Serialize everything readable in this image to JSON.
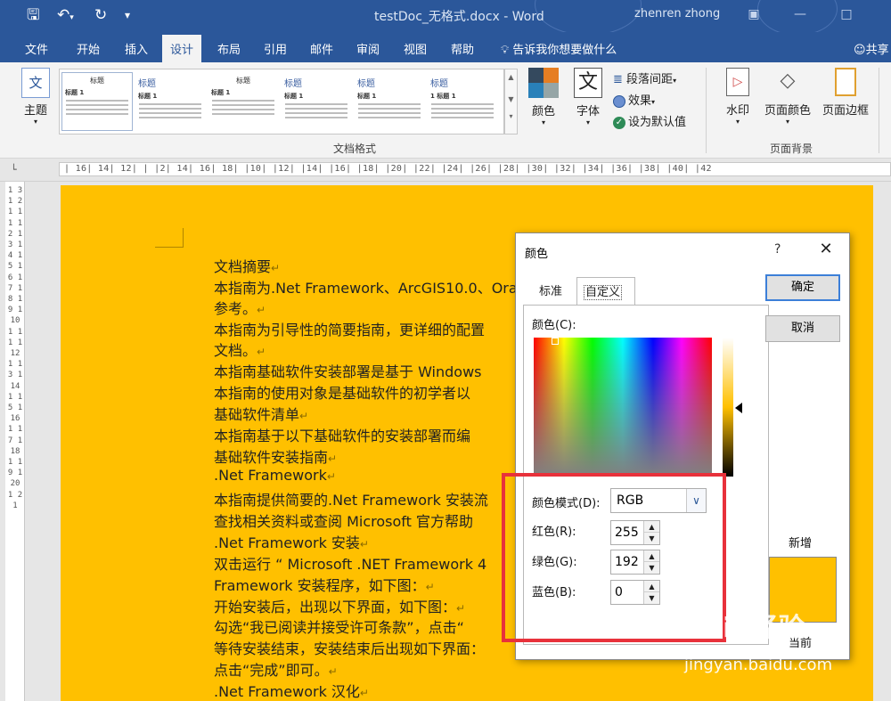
{
  "window": {
    "save_icon": "save-icon",
    "undo_icon": "undo-icon",
    "redo_icon": "redo-icon",
    "title": "testDoc_无格式.docx  -  Word",
    "user": "zhenren zhong"
  },
  "tabs": [
    "文件",
    "开始",
    "插入",
    "设计",
    "布局",
    "引用",
    "邮件",
    "审阅",
    "视图",
    "帮助"
  ],
  "active_tab": "设计",
  "tell_me": "告诉我你想要做什么",
  "share": "共享",
  "ribbon": {
    "theme_label": "主题",
    "theme_icon_text": "文",
    "gallery_thumbs": [
      {
        "title": "标题",
        "h1": "标题 1"
      },
      {
        "title": "标题",
        "h1": "标题 1"
      },
      {
        "title": "标题",
        "h1": "标题 1"
      },
      {
        "title": "标题",
        "h1": "标题 1"
      },
      {
        "title": "标题",
        "h1": "标题 1"
      },
      {
        "title": "标题",
        "h1": "1  标题 1"
      }
    ],
    "colors_label": "颜色",
    "fonts_label": "字体",
    "fonts_icon_text": "文",
    "paragraph_spacing": "段落间距",
    "effects": "效果",
    "set_default": "设为默认值",
    "doc_format_group": "文档格式",
    "watermark": "水印",
    "page_color": "页面颜色",
    "page_borders": "页面边框",
    "page_background_group": "页面背景"
  },
  "ruler_top": "| 16|  14|  12|  |  |2|  14|  16|  18|  |10|  |12|  |14|  |16|  |18|  |20|  |22|  |24|  |26|  |28|  |30|  |32|  |34|  |36|  |38|  |40|  |42",
  "ruler_left": "1 3 1 2 1 1 1 1 2 1 3 1 4 1 5 1 6 1 7 1 8 1 9 1 10 1 11 1 12 1 13 1 14 1 15 1 16 1 17 1 18 1 19 1 20 1 21",
  "document": {
    "lines": [
      "文档摘要",
      "本指南为.Net Framework、ArcGIS10.0、Orac",
      "参考。",
      "本指南为引导性的简要指南，更详细的配置",
      "文档。",
      "本指南基础软件安装部署是基于 Windows",
      "本指南的使用对象是基础软件的初学者以",
      "基础软件清单",
      "本指南基于以下基础软件的安装部署而编",
      "基础软件安装指南",
      ".Net Framework",
      "本指南提供简要的.Net Framework 安装流",
      "查找相关资料或查阅 Microsoft 官方帮助",
      ".Net Framework 安装",
      "双击运行 “ Microsoft  .NET  Framework  4",
      "Framework 安装程序，如下图：",
      "开始安装后，出现以下界面，如下图：",
      "勾选“我已阅读并接受许可条款”，点击“",
      "等待安装结束，安装结束后出现如下界面：",
      "点击“完成”即可。",
      ".Net Framework 汉化"
    ]
  },
  "dialog": {
    "title": "颜色",
    "help": "?",
    "tabs": [
      "标准",
      "自定义"
    ],
    "active_tab": "自定义",
    "colors_label": "颜色(C):",
    "mode_label": "颜色模式(D):",
    "mode_value": "RGB",
    "red_label": "红色(R):",
    "red_value": "255",
    "green_label": "绿色(G):",
    "green_value": "192",
    "blue_label": "蓝色(B):",
    "blue_value": "0",
    "ok": "确定",
    "cancel": "取消",
    "new_label": "新增",
    "current_label": "当前",
    "current_color": "#ffc000"
  },
  "watermark": {
    "logo_text": "Bai",
    "logo_text2": "经验",
    "url": "jingyan.baidu.com"
  },
  "colors": {
    "accent": "#2b579a",
    "page_color": "#ffc000",
    "highlight": "#e8313b"
  }
}
